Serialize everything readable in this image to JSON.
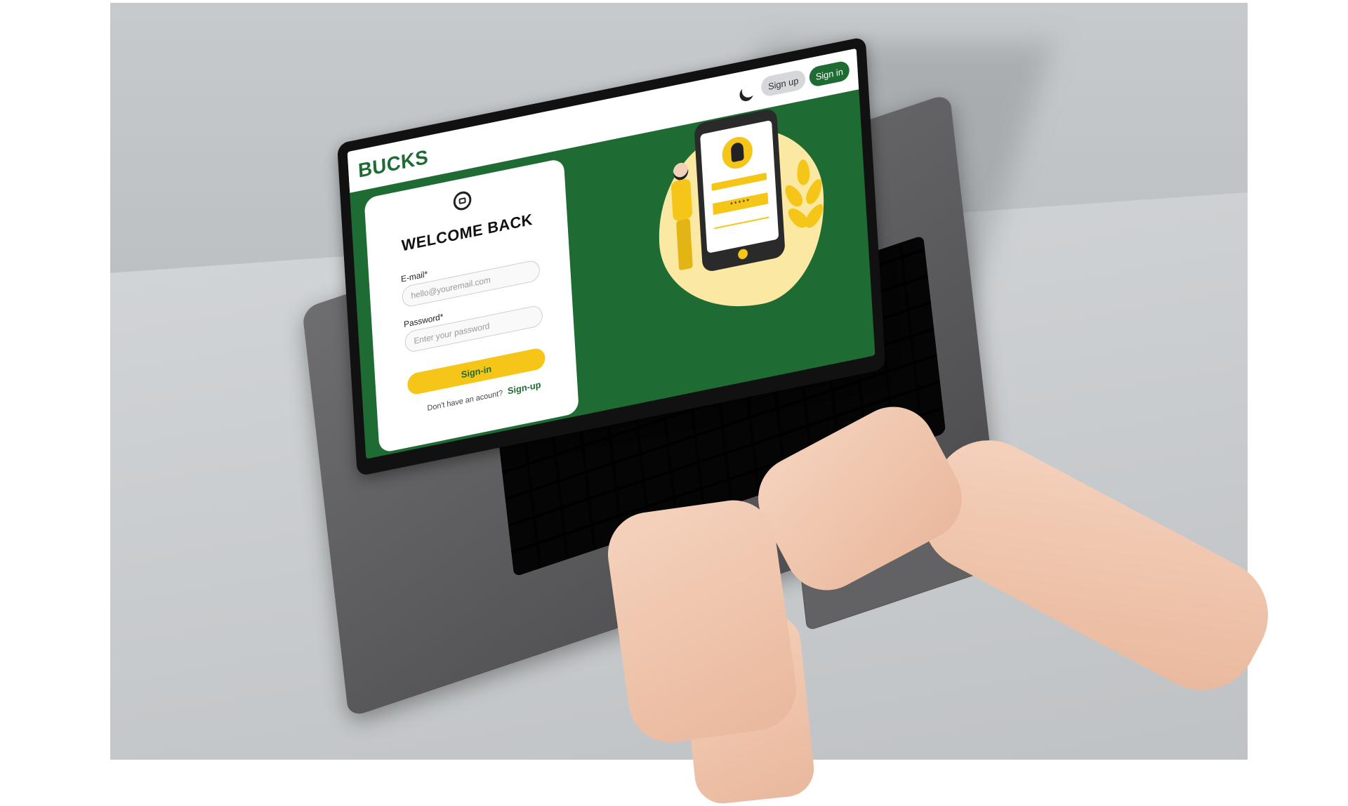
{
  "app": {
    "brand": "BUCKS"
  },
  "topbar": {
    "signup_label": "Sign up",
    "signin_label": "Sign in",
    "theme_icon": "moon-icon"
  },
  "login": {
    "icon": "lock-icon",
    "title": "WELCOME BACK",
    "email_label": "E-mail*",
    "email_placeholder": "hello@youremail.com",
    "password_label": "Password*",
    "password_placeholder": "Enter your password",
    "submit_label": "Sign-in",
    "signup_prompt": "Don't have an acount?",
    "signup_link": "Sign-up"
  },
  "illustration": {
    "password_mask": "*****"
  },
  "colors": {
    "brand_green": "#1e6b34",
    "accent_yellow": "#f5c518"
  }
}
